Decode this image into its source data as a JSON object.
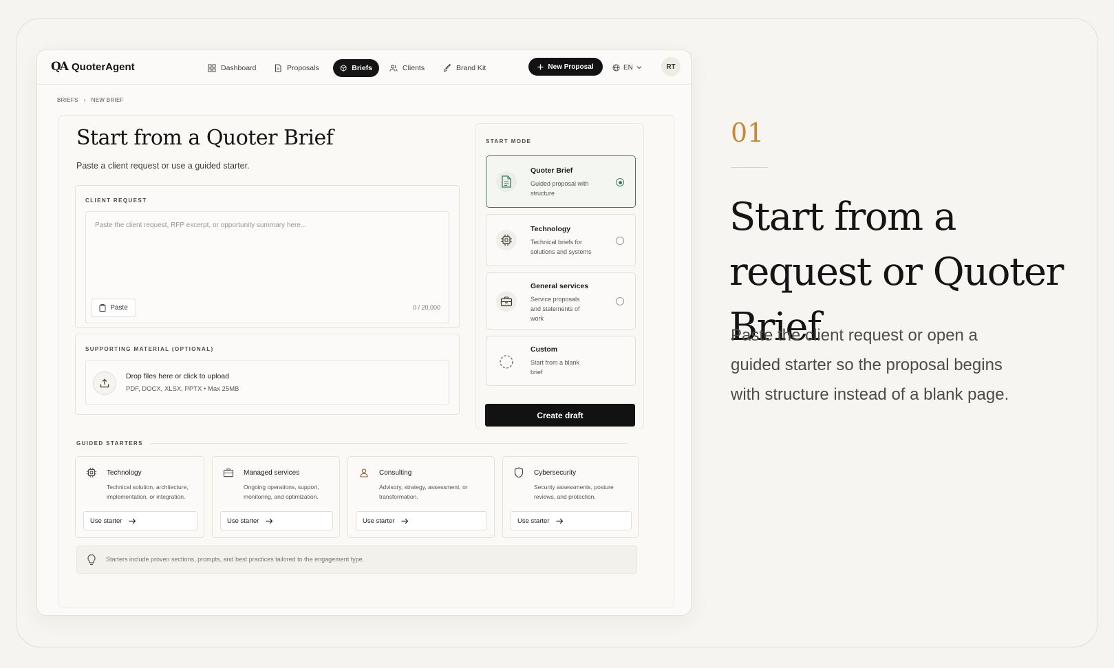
{
  "app": {
    "logo_mark": "QA",
    "name": "QuoterAgent",
    "nav": [
      {
        "label": "Dashboard",
        "icon": "grid-icon"
      },
      {
        "label": "Proposals",
        "icon": "document-icon"
      },
      {
        "label": "Briefs",
        "icon": "cube-icon",
        "active": true
      },
      {
        "label": "Clients",
        "icon": "users-icon"
      },
      {
        "label": "Brand Kit",
        "icon": "brush-icon"
      }
    ],
    "new_proposal_label": "New Proposal",
    "language": "EN",
    "avatar_initials": "RT"
  },
  "breadcrumb": [
    "BRIEFS",
    "NEW BRIEF"
  ],
  "page": {
    "title": "Start from a Quoter Brief",
    "subtitle": "Paste a client request or use a guided starter."
  },
  "client_request": {
    "label": "CLIENT REQUEST",
    "placeholder": "Paste the client request, RFP excerpt, or opportunity summary here...",
    "paste_label": "Paste",
    "counter": "0 / 20,000"
  },
  "supporting": {
    "label": "SUPPORTING MATERIAL (OPTIONAL)",
    "title": "Drop files here or click to upload",
    "formats": "PDF, DOCX, XLSX, PPTX • Max 25MB"
  },
  "start_mode": {
    "label": "START MODE",
    "options": [
      {
        "title": "Quoter Brief",
        "desc": "Guided proposal with structure",
        "icon": "document-icon",
        "selected": true
      },
      {
        "title": "Technology",
        "desc": "Technical briefs for solutions and systems",
        "icon": "chip-icon",
        "selected": false
      },
      {
        "title": "General services",
        "desc": "Service proposals and statements of work",
        "icon": "briefcase-icon",
        "selected": false
      },
      {
        "title": "Custom",
        "desc": "Start from a blank brief",
        "icon": "dashed-circle-icon",
        "selected": false
      }
    ],
    "create_label": "Create draft"
  },
  "guided_starters": {
    "label": "GUIDED STARTERS",
    "items": [
      {
        "title": "Technology",
        "desc": "Technical solution, architecture, implementation, or integration.",
        "button": "Use starter",
        "icon": "chip-icon"
      },
      {
        "title": "Managed services",
        "desc": "Ongoing operations, support, monitoring, and optimization.",
        "button": "Use starter",
        "icon": "briefcase-icon"
      },
      {
        "title": "Consulting",
        "desc": "Advisory, strategy, assessment, or transformation.",
        "button": "Use starter",
        "icon": "person-icon"
      },
      {
        "title": "Cybersecurity",
        "desc": "Security assessments, posture reviews, and protection.",
        "button": "Use starter",
        "icon": "shield-icon"
      }
    ],
    "tip": "Starters include proven sections, prompts, and best practices tailored to the engagement type."
  },
  "feature": {
    "number": "01",
    "title": "Start from a request or Quoter Brief",
    "description": "Paste the client request or open a guided starter so the proposal begins with structure instead of a blank page."
  },
  "colors": {
    "accent_gold": "#c48a3a",
    "selected_green": "#3f7a58",
    "primary_dark": "#121212"
  }
}
